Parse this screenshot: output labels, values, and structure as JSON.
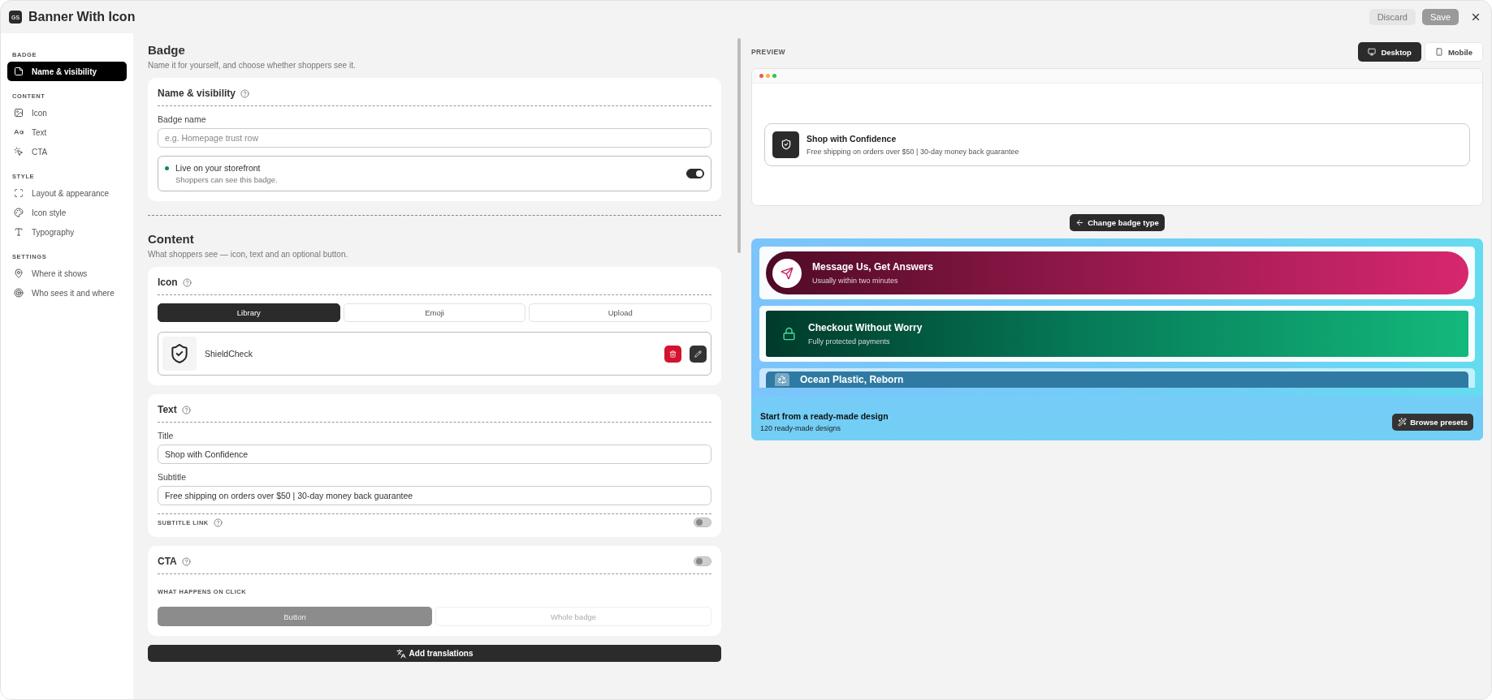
{
  "window": {
    "logo": "GS",
    "title": "Banner With Icon",
    "actions": [
      {
        "label": "Discard",
        "disabled": true
      },
      {
        "label": "Save",
        "disabled": true
      }
    ]
  },
  "sidebar": [
    {
      "heading": "BADGE",
      "items": [
        {
          "label": "Name & visibility",
          "selected": true
        }
      ]
    },
    {
      "heading": "CONTENT",
      "items": [
        {
          "label": "Icon",
          "selected": false
        },
        {
          "label": "Text",
          "selected": false
        },
        {
          "label": "CTA",
          "selected": false
        }
      ]
    },
    {
      "heading": "STYLE",
      "items": [
        {
          "label": "Layout & appearance",
          "selected": false
        },
        {
          "label": "Icon style",
          "selected": false
        },
        {
          "label": "Typography",
          "selected": false
        }
      ]
    },
    {
      "heading": "SETTINGS",
      "items": [
        {
          "label": "Where it shows",
          "selected": false
        },
        {
          "label": "Who sees it and where",
          "selected": false
        }
      ]
    }
  ],
  "form": {
    "badge": {
      "heading": "Badge",
      "description": "Name it for yourself, and choose whether shoppers see it.",
      "card_title": "Name & visibility",
      "field_label": "Badge name",
      "placeholder": "e.g. Homepage trust row",
      "visibility": {
        "title": "Live on your storefront",
        "subtitle": "Shoppers can see this badge.",
        "on": true
      }
    },
    "content": {
      "heading": "Content",
      "description": "What shoppers see — icon, text and an optional button.",
      "icon": {
        "title": "Icon",
        "tabs": [
          {
            "label": "Library",
            "selected": true
          },
          {
            "label": "Emoji",
            "selected": false
          },
          {
            "label": "Upload",
            "selected": false
          }
        ],
        "selected_icon": "ShieldCheck"
      },
      "text": {
        "title": "Text",
        "fields": [
          {
            "label": "Title",
            "value": "Shop with Confidence"
          },
          {
            "label": "Subtitle",
            "value": "Free shipping on orders over $50 | 30-day money back guarantee"
          }
        ],
        "subtitle_link": {
          "label": "SUBTITLE LINK",
          "on": false
        }
      },
      "cta": {
        "title": "CTA",
        "on": false,
        "click_label": "WHAT HAPPENS ON CLICK",
        "options": [
          {
            "label": "Button",
            "selected": true
          },
          {
            "label": "Whole badge",
            "selected": false
          }
        ]
      }
    },
    "translate_button": "Add translations"
  },
  "preview": {
    "label": "PREVIEW",
    "devices": [
      {
        "label": "Desktop",
        "selected": true
      },
      {
        "label": "Mobile",
        "selected": false
      }
    ],
    "badge": {
      "title": "Shop with Confidence",
      "subtitle": "Free shipping on orders over $50 | 30-day money back guarantee"
    },
    "change_type_button": "Change badge type",
    "presets": {
      "items": [
        {
          "kind": "pill",
          "title": "Message Us, Get Answers",
          "subtitle": "Usually within two minutes"
        },
        {
          "kind": "square",
          "title": "Checkout Without Worry",
          "subtitle": "Fully protected payments"
        },
        {
          "kind": "faded",
          "title": "Ocean Plastic, Reborn"
        }
      ],
      "heading": "Start from a ready-made design",
      "count": "120 ready-made designs",
      "browse_button": "Browse presets"
    }
  }
}
